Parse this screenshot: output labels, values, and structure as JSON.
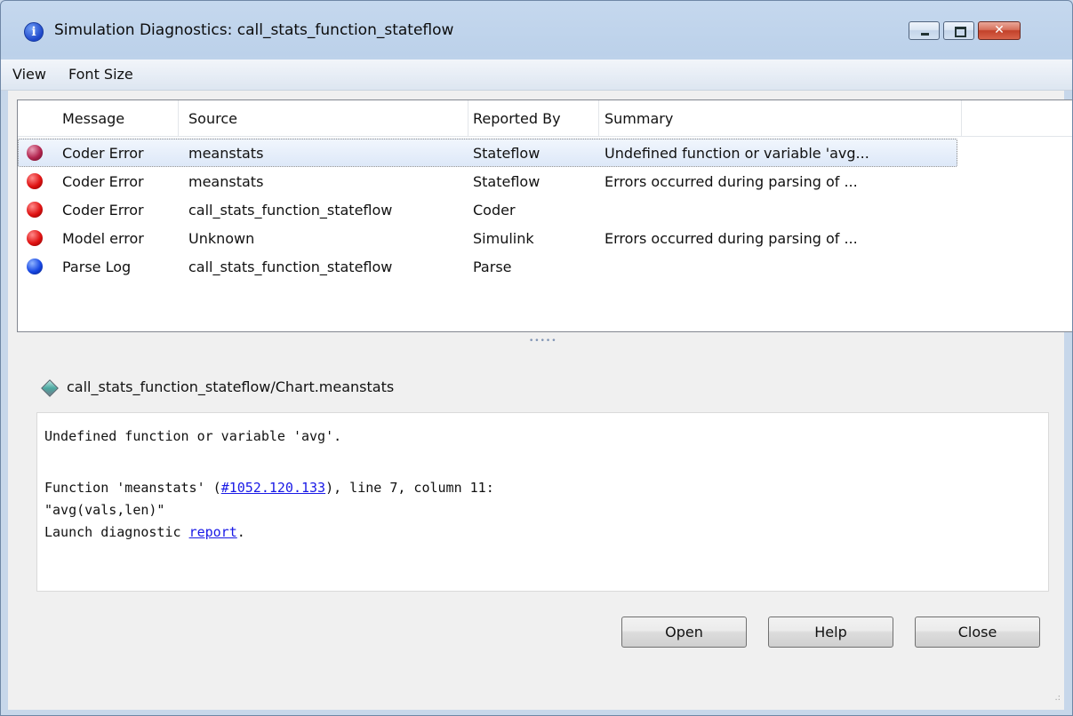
{
  "window": {
    "title": "Simulation Diagnostics: call_stats_function_stateflow",
    "close_glyph": "✕"
  },
  "menu": [
    "View",
    "Font Size"
  ],
  "table": {
    "columns": [
      "Message",
      "Source",
      "Reported By",
      "Summary"
    ],
    "rows": [
      {
        "icon": "error-icon",
        "message": "Coder Error",
        "source": "meanstats",
        "reported_by": "Stateflow",
        "summary": "Undefined function or variable 'avg...",
        "selected": true
      },
      {
        "icon": "error-icon",
        "message": "Coder Error",
        "source": "meanstats",
        "reported_by": "Stateflow",
        "summary": "Errors occurred during parsing of ..."
      },
      {
        "icon": "error-icon",
        "message": "Coder Error",
        "source": "call_stats_function_stateflow",
        "reported_by": "Coder",
        "summary": ""
      },
      {
        "icon": "error-icon",
        "message": "Model error",
        "source": "Unknown",
        "reported_by": "Simulink",
        "summary": "Errors occurred during parsing of ..."
      },
      {
        "icon": "info-icon",
        "message": "Parse Log",
        "source": "call_stats_function_stateflow",
        "reported_by": "Parse",
        "summary": ""
      }
    ]
  },
  "splitter": "•••••",
  "detail": {
    "path": "call_stats_function_stateflow/Chart.meanstats",
    "line1": "Undefined function or variable 'avg'.",
    "line2_prefix": "Function 'meanstats' (",
    "line2_link": "#1052.120.133",
    "line2_suffix": "), line 7, column 11:",
    "line3": "\"avg(vals,len)\"",
    "line4_prefix": "Launch diagnostic ",
    "line4_link": "report",
    "line4_suffix": "."
  },
  "buttons": {
    "open": "Open",
    "help": "Help",
    "close": "Close"
  },
  "grip": ".:"
}
